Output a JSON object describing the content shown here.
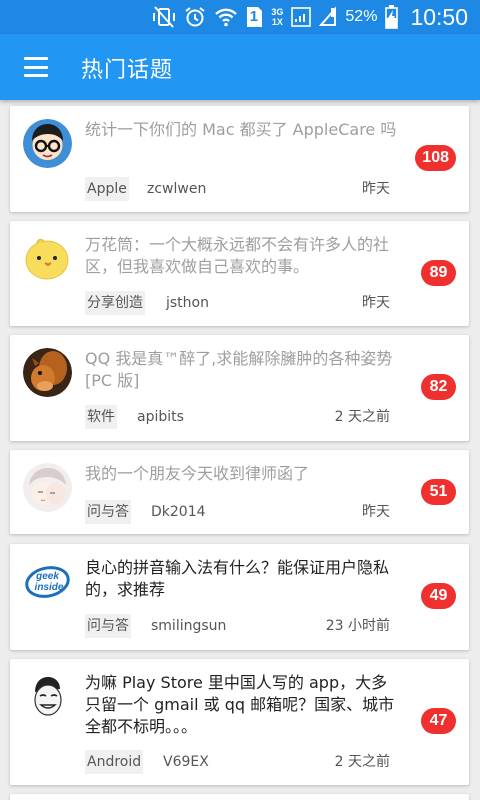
{
  "status_bar": {
    "battery_percent": "52%",
    "time": "10:50",
    "sim_slot": "1",
    "network_type_top": "3G",
    "network_type_bottom": "1X",
    "icons": [
      "vibrate-off-icon",
      "alarm-icon",
      "wifi-icon",
      "sim-icon",
      "signal-icon",
      "roaming-signal-icon",
      "battery-charging-icon"
    ]
  },
  "app_bar": {
    "title": "热门话题",
    "menu_icon": "hamburger-menu-icon"
  },
  "colors": {
    "status_bar": "#1e88e5",
    "app_bar": "#2196f3",
    "badge": "#f0302f",
    "read_title": "#9e9e9e",
    "unread_title": "#222222"
  },
  "topics": [
    {
      "title": "统计一下你们的 Mac 都买了 AppleCare 吗",
      "node": "Apple",
      "author": "zcwlwen",
      "time": "昨天",
      "replies": "108",
      "read": true,
      "avatar": "glasses-avatar"
    },
    {
      "title": "万花筒：一个大概永远都不会有许多人的社区，但我喜欢做自己喜欢的事。",
      "node": "分享创造",
      "author": "jsthon",
      "time": "昨天",
      "replies": "89",
      "read": true,
      "avatar": "yellow-chick-avatar"
    },
    {
      "title": "QQ 我是真™醉了,求能解除臃肿的各种姿势[PC 版]",
      "node": "软件",
      "author": "apibits",
      "time": "2 天之前",
      "replies": "82",
      "read": true,
      "avatar": "squirrel-avatar"
    },
    {
      "title": "我的一个朋友今天收到律师函了",
      "node": "问与答",
      "author": "Dk2014",
      "time": "昨天",
      "replies": "51",
      "read": true,
      "avatar": "anime-avatar"
    },
    {
      "title": "良心的拼音输入法有什么？能保证用户隐私的，求推荐",
      "node": "问与答",
      "author": "smilingsun",
      "time": "23 小时前",
      "replies": "49",
      "read": false,
      "avatar": "geek-inside-avatar"
    },
    {
      "title": "为嘛 Play Store 里中国人写的 app，大多只留一个 gmail 或 qq 邮箱呢？国家、城市全都不标明。。。",
      "node": "Android",
      "author": "V69EX",
      "time": "2 天之前",
      "replies": "47",
      "read": false,
      "avatar": "sketch-face-avatar"
    }
  ]
}
